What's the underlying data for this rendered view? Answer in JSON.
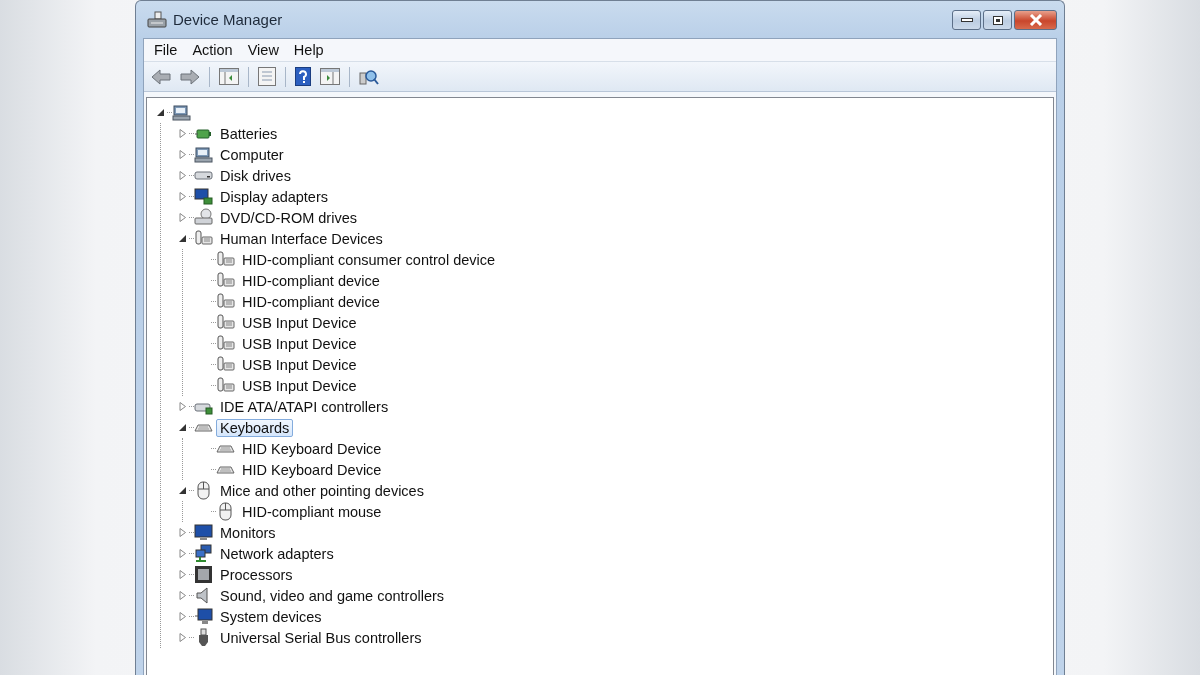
{
  "window": {
    "title": "Device Manager"
  },
  "menu": [
    "File",
    "Action",
    "View",
    "Help"
  ],
  "tree": {
    "kind": "computer",
    "expanded": true,
    "children": [
      {
        "label": "Batteries",
        "kind": "battery",
        "expanded": false,
        "selected": false
      },
      {
        "label": "Computer",
        "kind": "computer",
        "expanded": false,
        "selected": false
      },
      {
        "label": "Disk drives",
        "kind": "disk",
        "expanded": false,
        "selected": false
      },
      {
        "label": "Display adapters",
        "kind": "display",
        "expanded": false,
        "selected": false
      },
      {
        "label": "DVD/CD-ROM drives",
        "kind": "dvd",
        "expanded": false,
        "selected": false
      },
      {
        "label": "Human Interface Devices",
        "kind": "hid",
        "expanded": true,
        "selected": false,
        "children": [
          {
            "label": "HID-compliant consumer control device",
            "kind": "hid",
            "selected": false
          },
          {
            "label": "HID-compliant device",
            "kind": "hid",
            "selected": false
          },
          {
            "label": "HID-compliant device",
            "kind": "hid",
            "selected": false
          },
          {
            "label": "USB Input Device",
            "kind": "hid",
            "selected": false
          },
          {
            "label": "USB Input Device",
            "kind": "hid",
            "selected": false
          },
          {
            "label": "USB Input Device",
            "kind": "hid",
            "selected": false
          },
          {
            "label": "USB Input Device",
            "kind": "hid",
            "selected": false
          }
        ]
      },
      {
        "label": "IDE ATA/ATAPI controllers",
        "kind": "ide",
        "expanded": false,
        "selected": false
      },
      {
        "label": "Keyboards",
        "kind": "keyboard",
        "expanded": true,
        "selected": true,
        "children": [
          {
            "label": "HID Keyboard Device",
            "kind": "keyboard",
            "selected": false
          },
          {
            "label": "HID Keyboard Device",
            "kind": "keyboard",
            "selected": false
          }
        ]
      },
      {
        "label": "Mice and other pointing devices",
        "kind": "mouse",
        "expanded": true,
        "selected": false,
        "children": [
          {
            "label": "HID-compliant mouse",
            "kind": "mouse",
            "selected": false
          }
        ]
      },
      {
        "label": "Monitors",
        "kind": "monitor",
        "expanded": false,
        "selected": false
      },
      {
        "label": "Network adapters",
        "kind": "network",
        "expanded": false,
        "selected": false
      },
      {
        "label": "Processors",
        "kind": "processor",
        "expanded": false,
        "selected": false
      },
      {
        "label": "Sound, video and game controllers",
        "kind": "sound",
        "expanded": false,
        "selected": false
      },
      {
        "label": "System devices",
        "kind": "system",
        "expanded": false,
        "selected": false
      },
      {
        "label": "Universal Serial Bus controllers",
        "kind": "usb",
        "expanded": false,
        "selected": false
      }
    ]
  }
}
